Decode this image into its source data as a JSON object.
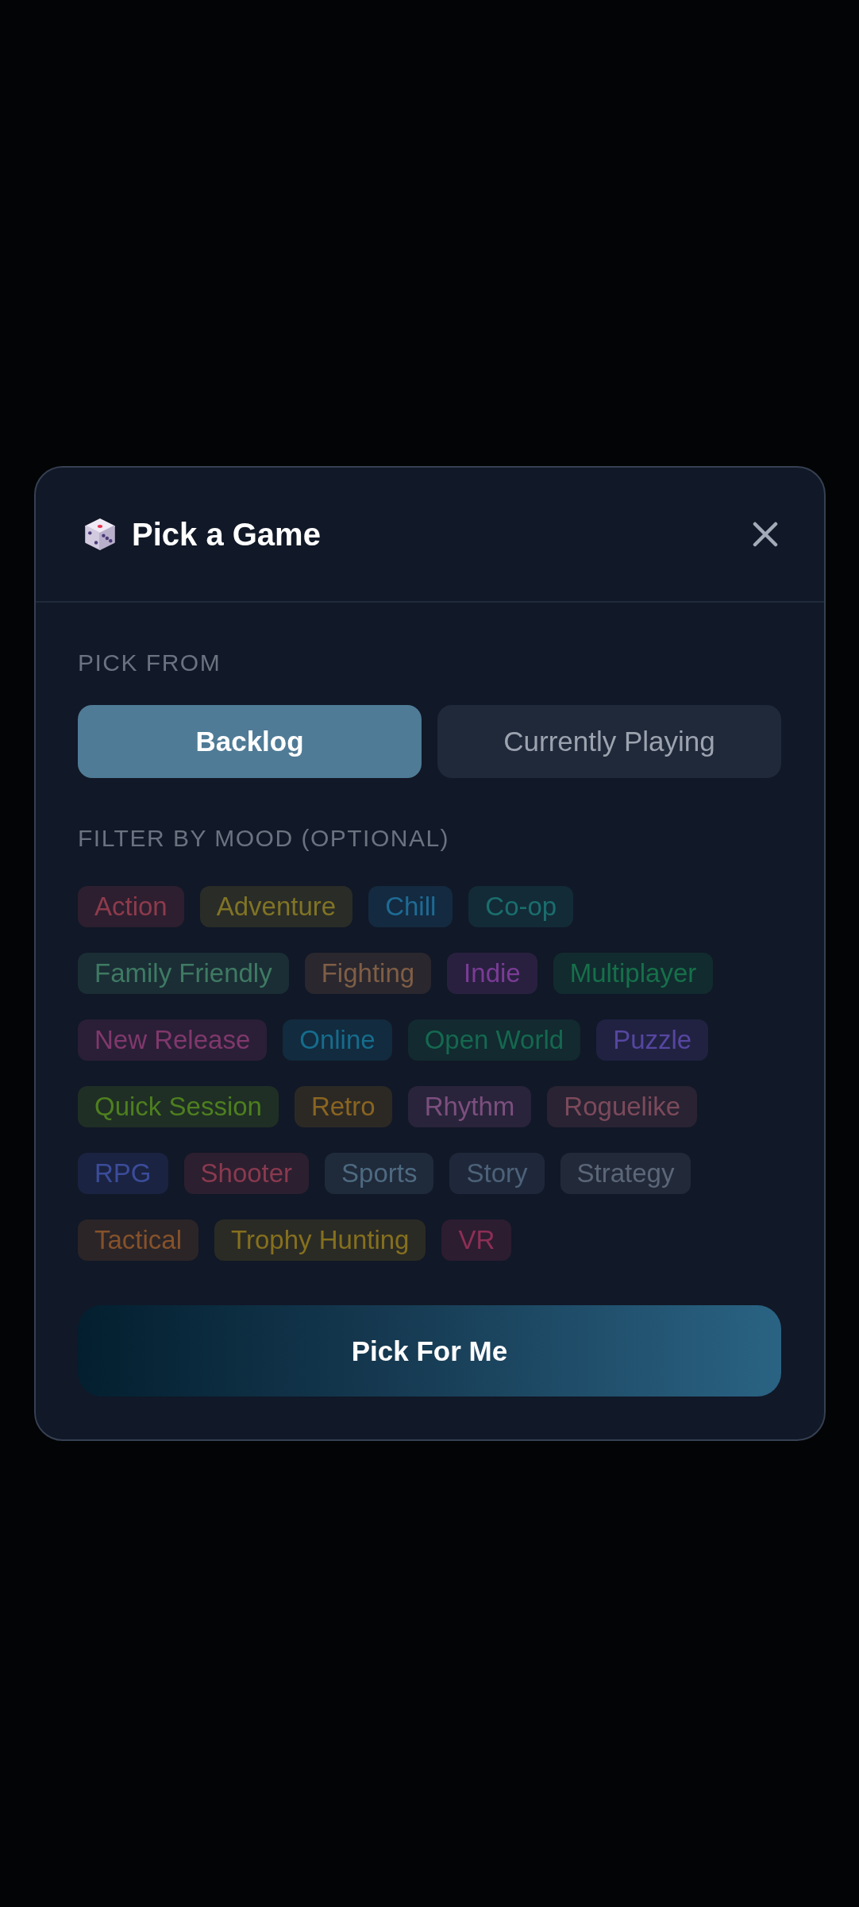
{
  "dialog": {
    "title": "Pick a Game"
  },
  "pick_from": {
    "label": "PICK FROM",
    "options": [
      {
        "label": "Backlog",
        "selected": true
      },
      {
        "label": "Currently Playing",
        "selected": false
      }
    ]
  },
  "mood_filter": {
    "label": "FILTER BY MOOD (OPTIONAL)",
    "moods": [
      {
        "label": "Action",
        "color": "#8e3b4c",
        "selected": false
      },
      {
        "label": "Adventure",
        "color": "#807426",
        "selected": false
      },
      {
        "label": "Chill",
        "color": "#1e6b94",
        "selected": false
      },
      {
        "label": "Co-op",
        "color": "#1a6e6e",
        "selected": false
      },
      {
        "label": "Family Friendly",
        "color": "#3f7a63",
        "selected": false
      },
      {
        "label": "Fighting",
        "color": "#7f5e46",
        "selected": false
      },
      {
        "label": "Indie",
        "color": "#7a3c95",
        "selected": false
      },
      {
        "label": "Multiplayer",
        "color": "#16704a",
        "selected": false
      },
      {
        "label": "New Release",
        "color": "#80386c",
        "selected": false
      },
      {
        "label": "Online",
        "color": "#166c8c",
        "selected": false
      },
      {
        "label": "Open World",
        "color": "#15684f",
        "selected": false
      },
      {
        "label": "Puzzle",
        "color": "#5646a0",
        "selected": false
      },
      {
        "label": "Quick Session",
        "color": "#4e7f1f",
        "selected": false
      },
      {
        "label": "Retro",
        "color": "#8a6520",
        "selected": false
      },
      {
        "label": "Rhythm",
        "color": "#7c4f7e",
        "selected": false
      },
      {
        "label": "Roguelike",
        "color": "#7c4a5b",
        "selected": false
      },
      {
        "label": "RPG",
        "color": "#3b4c9a",
        "selected": false
      },
      {
        "label": "Shooter",
        "color": "#8a3a4e",
        "selected": false
      },
      {
        "label": "Sports",
        "color": "#4e6a80",
        "selected": false
      },
      {
        "label": "Story",
        "color": "#4d6279",
        "selected": false
      },
      {
        "label": "Strategy",
        "color": "#5b6778",
        "selected": false
      },
      {
        "label": "Tactical",
        "color": "#86522a",
        "selected": false
      },
      {
        "label": "Trophy Hunting",
        "color": "#85701e",
        "selected": false
      },
      {
        "label": "VR",
        "color": "#8d2f55",
        "selected": false
      }
    ]
  },
  "primary_button": {
    "label": "Pick For Me"
  }
}
